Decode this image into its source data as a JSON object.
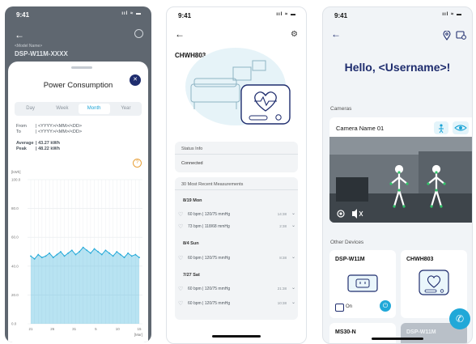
{
  "screens": {
    "consumption": {
      "status_time": "9:41",
      "status_icons": "ııl ≈ ▬",
      "back_icon": "←",
      "bg_label": "<Model Name>",
      "bg_title": "DSP-W11M-XXXX",
      "title": "Power Consumption",
      "close_icon": "✕",
      "tabs": [
        "Day",
        "Week",
        "Month",
        "Year"
      ],
      "active_tab": "Month",
      "from_label": "From",
      "from_value": "| <YYYY>/<MM>/<DD>",
      "to_label": "To",
      "to_value": "| <YYYY>/<MM>/<DD>",
      "average_label": "Average",
      "average_value": "| 43.27 kWh",
      "peak_label": "Peak",
      "peak_value": "| 48.22 kWh",
      "help_icon": "?"
    },
    "device": {
      "status_time": "9:41",
      "status_icons": "ııl ≈ ▬",
      "back_icon": "←",
      "gear_icon": "⚙",
      "title": "CHWH803",
      "status_header": "Status Info",
      "status_value": "Connected",
      "measurements_header": "30 Most Recent Measurements",
      "groups": [
        {
          "date": "8/19 Mon",
          "rows": [
            {
              "text": "60 bpm | 120/75 mmHg",
              "time": "14:38"
            },
            {
              "text": "73 bpm | 118/68 mmHg",
              "time": "2:38"
            }
          ]
        },
        {
          "date": "8/4 Sun",
          "rows": [
            {
              "text": "60 bpm | 120/75 mmHg",
              "time": "8:38"
            }
          ]
        },
        {
          "date": "7/27 Sat",
          "rows": [
            {
              "text": "60 bpm | 120/75 mmHg",
              "time": "21:38"
            },
            {
              "text": "60 bpm | 120/75 mmHg",
              "time": "10:38"
            }
          ]
        }
      ]
    },
    "home": {
      "status_time": "9:41",
      "status_icons": "ııl ≈ ▬",
      "back_icon": "←",
      "greeting": "Hello, <Username>!",
      "cameras_label": "Cameras",
      "camera_name": "Camera Name 01",
      "other_devices_label": "Other Devices",
      "devices": [
        {
          "name": "DSP-W11M",
          "state": "On"
        },
        {
          "name": "CHWH803"
        },
        {
          "name": "MS30-N"
        },
        {
          "name": "DSP-W11M"
        }
      ]
    }
  },
  "chart_data": {
    "type": "area",
    "title": "",
    "ylabel": "[kWh]",
    "xlabel": "[Mar]",
    "ylim": [
      0,
      100
    ],
    "yticks": [
      "100.0",
      "80.0",
      "60.0",
      "40.0",
      "20.0",
      "0.0"
    ],
    "xticks": [
      "21",
      "26",
      "31",
      "5",
      "10",
      "15"
    ],
    "values": [
      47,
      45,
      48,
      46,
      47,
      49,
      46,
      48,
      50,
      47,
      49,
      51,
      48,
      50,
      53,
      51,
      49,
      52,
      50,
      48,
      51,
      49,
      47,
      50,
      48,
      46,
      49,
      47,
      48,
      46
    ],
    "color": "#21a8d8"
  }
}
